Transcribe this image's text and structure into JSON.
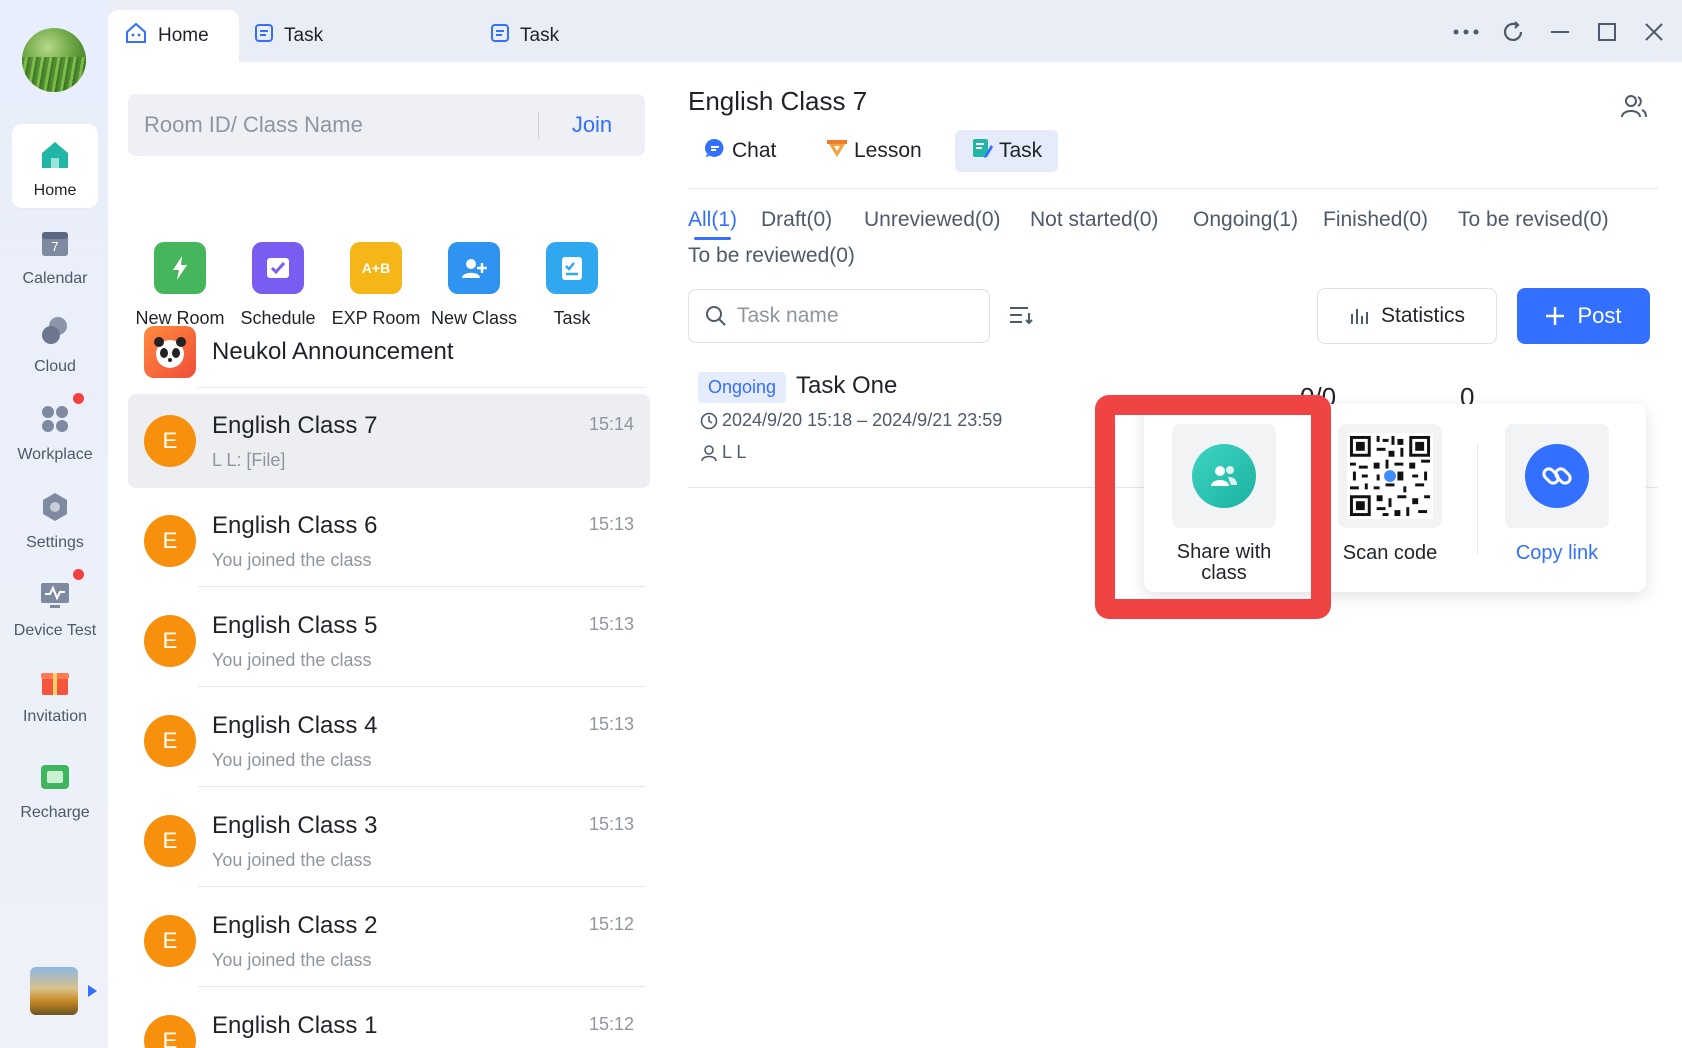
{
  "window": {
    "tabs": [
      {
        "label": "Home",
        "active": true
      },
      {
        "label": "Task",
        "active": false
      },
      {
        "label": "Task",
        "active": false
      }
    ]
  },
  "sidebar": {
    "items": [
      {
        "label": "Home",
        "icon": "home-icon",
        "active": true
      },
      {
        "label": "Calendar",
        "icon": "calendar-icon",
        "date": "7"
      },
      {
        "label": "Cloud",
        "icon": "cloud-icon"
      },
      {
        "label": "Workplace",
        "icon": "workplace-icon",
        "dot": true
      },
      {
        "label": "Settings",
        "icon": "settings-icon"
      },
      {
        "label": "Device Test",
        "icon": "device-test-icon",
        "dot": true
      },
      {
        "label": "Invitation",
        "icon": "gift-icon"
      },
      {
        "label": "Recharge",
        "icon": "wallet-icon"
      }
    ]
  },
  "join": {
    "placeholder": "Room ID/ Class Name",
    "button": "Join"
  },
  "quick_actions": [
    {
      "label": "New Room",
      "icon": "new-room-icon"
    },
    {
      "label": "Schedule",
      "icon": "schedule-icon"
    },
    {
      "label": "EXP Room",
      "icon": "exp-room-icon",
      "badge": "A+B"
    },
    {
      "label": "New Class",
      "icon": "new-class-icon"
    },
    {
      "label": "Task",
      "icon": "task-icon"
    }
  ],
  "announcement": {
    "title": "Neukol Announcement"
  },
  "conversations": [
    {
      "avatar": "E",
      "name": "English Class 7",
      "sub": "L L: [File]",
      "time": "15:14",
      "active": true
    },
    {
      "avatar": "E",
      "name": "English Class 6",
      "sub": "You joined the class",
      "time": "15:13"
    },
    {
      "avatar": "E",
      "name": "English Class 5",
      "sub": "You joined the class",
      "time": "15:13"
    },
    {
      "avatar": "E",
      "name": "English Class 4",
      "sub": "You joined the class",
      "time": "15:13"
    },
    {
      "avatar": "E",
      "name": "English Class 3",
      "sub": "You joined the class",
      "time": "15:13"
    },
    {
      "avatar": "E",
      "name": "English Class 2",
      "sub": "You joined the class",
      "time": "15:12"
    },
    {
      "avatar": "E",
      "name": "English Class 1",
      "sub": "",
      "time": "15:12"
    }
  ],
  "main": {
    "title": "English Class 7",
    "subtabs": [
      {
        "label": "Chat",
        "icon": "chat-icon"
      },
      {
        "label": "Lesson",
        "icon": "lesson-icon"
      },
      {
        "label": "Task",
        "icon": "task-icon",
        "active": true
      }
    ],
    "filters": [
      {
        "label": "All(1)",
        "active": true
      },
      {
        "label": "Draft(0)"
      },
      {
        "label": "Unreviewed(0)"
      },
      {
        "label": "Not started(0)"
      },
      {
        "label": "Ongoing(1)"
      },
      {
        "label": "Finished(0)"
      },
      {
        "label": "To be revised(0)"
      },
      {
        "label": "To be reviewed(0)"
      }
    ],
    "search_placeholder": "Task name",
    "statistics_label": "Statistics",
    "post_label": "Post",
    "task": {
      "status": "Ongoing",
      "name": "Task One",
      "date_range": "2024/9/20 15:18 – 2024/9/21 23:59",
      "owner": "L L",
      "peek_a": "0/0",
      "peek_b": "0"
    }
  },
  "share_popover": {
    "options": [
      {
        "label": "Share with class",
        "icon": "share-class-icon"
      },
      {
        "label": "Scan code",
        "icon": "qr-code-icon"
      },
      {
        "label": "Copy link",
        "icon": "link-icon"
      }
    ]
  },
  "colors": {
    "accent": "#3370ff",
    "highlight": "#f04343",
    "avatar": "#f7900d",
    "teal": "#22c1b0"
  }
}
